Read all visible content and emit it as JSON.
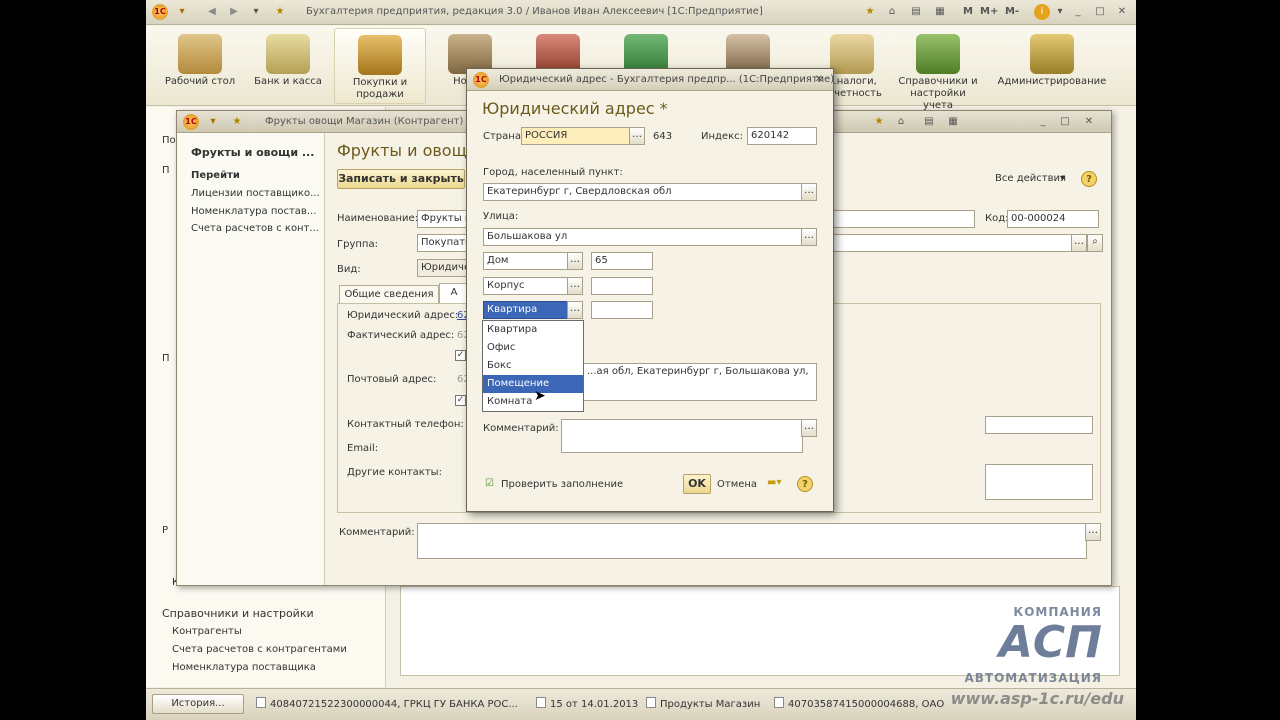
{
  "app": {
    "title": "Бухгалтерия предприятия, редакция 3.0 / Иванов Иван Алексеевич [1С:Предприятие]",
    "top_right_buttons": [
      "M",
      "M+",
      "M-"
    ]
  },
  "sections": [
    {
      "label": "Рабочий стол",
      "icon": "desk-icon"
    },
    {
      "label": "Банк и касса",
      "icon": "bank-icon"
    },
    {
      "label": "Покупки и продажи",
      "icon": "truck-icon"
    },
    {
      "label": "Номен",
      "icon": "warehouse-icon"
    },
    {
      "label": "",
      "icon": "tools-icon"
    },
    {
      "label": "",
      "icon": "production-icon"
    },
    {
      "label": "",
      "icon": "person-icon"
    },
    {
      "label": "...налоги, отчетность",
      "icon": "reports-icon"
    },
    {
      "label": "Справочники и настройки учета",
      "icon": "binders-icon"
    },
    {
      "label": "Администрирование",
      "icon": "admin-icon"
    }
  ],
  "left_panel": {
    "letters": [
      "По",
      "П",
      "П",
      "Р",
      "К"
    ],
    "group": "Справочники и настройки",
    "links": [
      "Контрагенты",
      "Счета расчетов с контрагентами",
      "Номенклатура поставщика"
    ]
  },
  "window2": {
    "title": "Фрукты овощи Магазин (Контрагент) - ...",
    "nav_title": "Фрукты и овощи ...",
    "nav_group": "Перейти",
    "nav_links": [
      "Лицензии поставщико...",
      "Номенклатура постав...",
      "Счета расчетов с конт..."
    ],
    "heading": "Фрукты и овощ...",
    "save_close": "Записать и закрыть",
    "all_actions": "Все действия",
    "labels": {
      "name": "Наименование:",
      "group": "Группа:",
      "kind": "Вид:",
      "code": "Код:",
      "legal_addr": "Юридический адрес:",
      "actual_addr": "Фактический адрес:",
      "postal_addr": "Почтовый адрес:",
      "phone": "Контактный телефон:",
      "email": "Email:",
      "other": "Другие контакты:",
      "comment": "Комментарий:"
    },
    "values": {
      "name": "Фрукты и",
      "group": "Покупате",
      "kind": "Юридичес",
      "code": "00-000024",
      "legal_addr_link": "62",
      "actual_addr_short": "62",
      "postal_addr_short": "62"
    },
    "tabs": [
      "Общие сведения",
      "А"
    ]
  },
  "dialog": {
    "title": "Юридический адрес - Бухгалтерия предпр... (1С:Предприятие)",
    "heading": "Юридический адрес *",
    "country_label": "Страна:",
    "country_value": "РОССИЯ",
    "country_code": "643",
    "index_label": "Индекс:",
    "index_value": "620142",
    "city_label": "Город, населенный пункт:",
    "city_value": "Екатеринбург г, Свердловская обл",
    "street_label": "Улица:",
    "street_value": "Большакова ул",
    "house_type": "Дом",
    "house_value": "65",
    "building_type": "Корпус",
    "building_value": "",
    "apartment_type": "Квартира",
    "apartment_value": "",
    "presentation": "...ая обл, Екатеринбург г, Большакова ул, дом",
    "comment_label": "Комментарий:",
    "check_label": "Проверить заполнение",
    "ok": "OK",
    "cancel": "Отмена",
    "dropdown_items": [
      "Квартира",
      "Офис",
      "Бокс",
      "Помещение",
      "Комната"
    ],
    "dropdown_selected": 3
  },
  "statusbar": {
    "history": "История...",
    "tasks": [
      "40840721522300000044, ГРКЦ ГУ БАНКА РОС...",
      "15 от 14.01.2013",
      "Продукты Магазин",
      "40703587415000004688, ОАО"
    ]
  },
  "watermark": {
    "top": "КОМПАНИЯ",
    "logo": "АСП",
    "bottom": "АВТОМАТИЗАЦИЯ",
    "url": "www.asp-1c.ru/edu"
  }
}
